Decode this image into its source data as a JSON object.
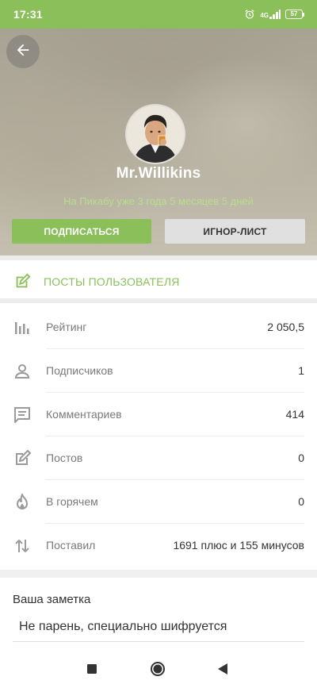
{
  "status_bar": {
    "time": "17:31",
    "network": "4G",
    "battery": "57",
    "icons": [
      "alarm-icon",
      "signal-icon",
      "battery-icon"
    ]
  },
  "header": {
    "back_icon": "arrow-left-icon",
    "username": "Mr.Willikins",
    "since": "На Пикабу уже 3 года 5 месяцев 5 дней",
    "subscribe_label": "ПОДПИСАТЬСЯ",
    "ignore_label": "ИГНОР-ЛИСТ"
  },
  "posts_link": {
    "label": "ПОСТЫ ПОЛЬЗОВАТЕЛЯ",
    "icon": "edit-icon"
  },
  "stats": [
    {
      "icon": "bar-chart-icon",
      "label": "Рейтинг",
      "value": "2 050,5"
    },
    {
      "icon": "person-icon",
      "label": "Подписчиков",
      "value": "1"
    },
    {
      "icon": "comment-icon",
      "label": "Комментариев",
      "value": "414"
    },
    {
      "icon": "edit-icon",
      "label": "Постов",
      "value": "0"
    },
    {
      "icon": "flame-icon",
      "label": "В горячем",
      "value": "0"
    },
    {
      "icon": "swap-vertical-icon",
      "label": "Поставил",
      "value": "1691 плюс и 155 минусов"
    }
  ],
  "note": {
    "label": "Ваша заметка",
    "value": "Не парень, специально шифруется"
  },
  "colors": {
    "accent": "#8bbf5a",
    "accent_light": "#b6df8a",
    "secondary_button": "#e0e0e0"
  },
  "navbar": {
    "icons": [
      "recent-apps-icon",
      "home-icon",
      "back-triangle-icon"
    ]
  }
}
